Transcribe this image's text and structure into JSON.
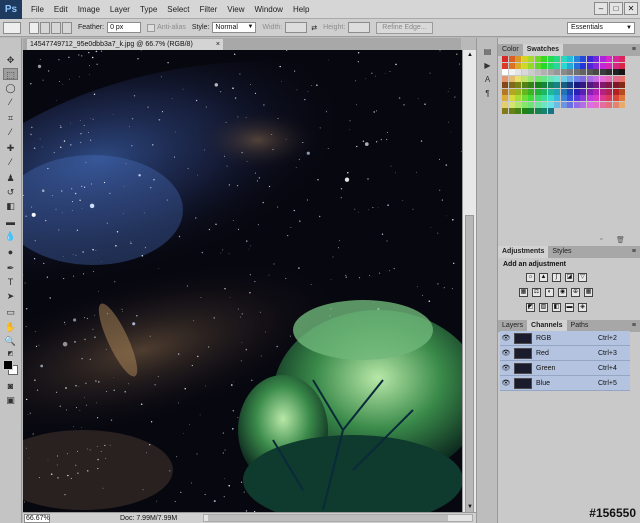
{
  "app": {
    "logo": "Ps"
  },
  "menu": [
    "File",
    "Edit",
    "Image",
    "Layer",
    "Type",
    "Select",
    "Filter",
    "View",
    "Window",
    "Help"
  ],
  "window_controls": {
    "minimize": "–",
    "maximize": "□",
    "close": "✕"
  },
  "options": {
    "feather_label": "Feather:",
    "feather_value": "0 px",
    "antialias_label": "Anti-alias",
    "style_label": "Style:",
    "style_value": "Normal",
    "width_label": "Width:",
    "height_label": "Height:",
    "refine_label": "Refine Edge...",
    "workspace": "Essentials"
  },
  "document": {
    "tab_title": "14547749712_95e0dbb3a7_k.jpg @ 66.7% (RGB/8)",
    "tab_close": "×"
  },
  "status": {
    "zoom": "66.67%",
    "doc_info": "Doc: 7.99M/7.99M"
  },
  "panels": {
    "swatches_tabs": [
      "Color",
      "Swatches"
    ],
    "adjustments_tabs": [
      "Adjustments",
      "Styles"
    ],
    "adjustments_title": "Add an adjustment",
    "layers_tabs": [
      "Layers",
      "Channels",
      "Paths"
    ],
    "menu_icon": "≡"
  },
  "channels": [
    {
      "name": "RGB",
      "key": "Ctrl+2"
    },
    {
      "name": "Red",
      "key": "Ctrl+3"
    },
    {
      "name": "Green",
      "key": "Ctrl+4"
    },
    {
      "name": "Blue",
      "key": "Ctrl+5"
    }
  ],
  "watermark": "#156550",
  "icons": {
    "tools": [
      "move-icon",
      "marquee-icon",
      "lasso-icon",
      "quick-select-icon",
      "crop-icon",
      "eyedropper-icon",
      "healing-icon",
      "brush-icon",
      "stamp-icon",
      "history-brush-icon",
      "eraser-icon",
      "gradient-icon",
      "blur-icon",
      "dodge-icon",
      "pen-icon",
      "type-icon",
      "path-select-icon",
      "shape-icon",
      "hand-icon",
      "zoom-icon"
    ]
  },
  "colors": {
    "accent": "#b4c3df",
    "canvas_bg": "#050510"
  }
}
